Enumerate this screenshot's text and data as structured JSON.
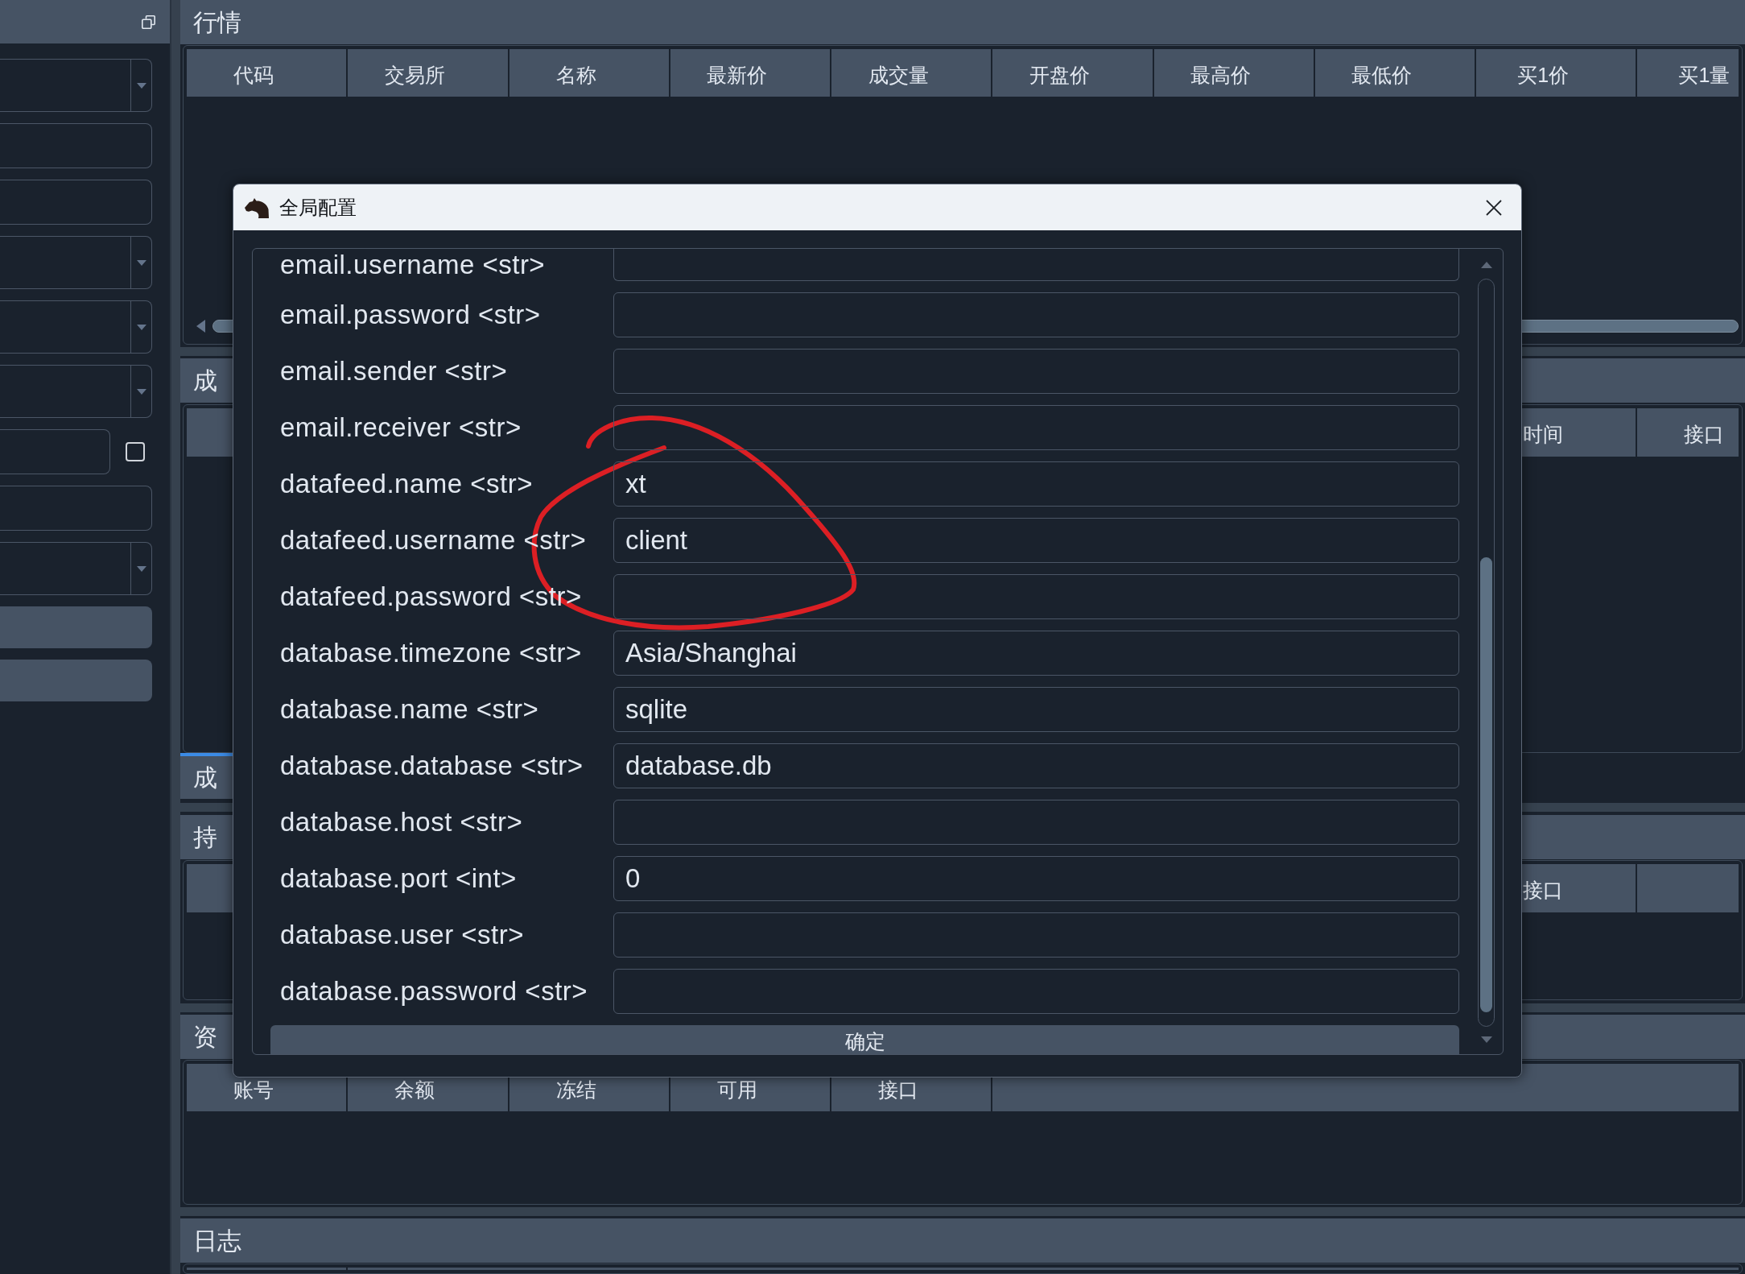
{
  "side_panel": {
    "controls": [
      {
        "kind": "dropdown"
      },
      {
        "kind": "input"
      },
      {
        "kind": "input"
      },
      {
        "kind": "dropdown"
      },
      {
        "kind": "dropdown"
      },
      {
        "kind": "dropdown"
      },
      {
        "kind": "input_checkbox",
        "checked": false
      },
      {
        "kind": "input"
      },
      {
        "kind": "dropdown"
      },
      {
        "kind": "button"
      },
      {
        "kind": "button"
      }
    ]
  },
  "docks": [
    {
      "title": "行情",
      "table": {
        "kind": "wide",
        "columns": [
          "代码",
          "交易所",
          "名称",
          "最新价",
          "成交量",
          "开盘价",
          "最高价",
          "最低价",
          "买1价",
          "买1量"
        ]
      }
    },
    {
      "title": "成",
      "table": {
        "kind": "covered",
        "columns": [
          "时间",
          "接口"
        ]
      },
      "tabs": [
        {
          "label": "成",
          "selected": true
        }
      ]
    },
    {
      "title": "持",
      "table": {
        "kind": "covered",
        "columns": [
          "接口"
        ]
      }
    },
    {
      "title": "资",
      "table": {
        "kind": "plain",
        "columns": [
          "账号",
          "余额",
          "冻结",
          "可用",
          "接口"
        ]
      }
    },
    {
      "title": "日志",
      "table": {
        "kind": "clipped"
      }
    }
  ],
  "dialog": {
    "title": "全局配置",
    "settings": [
      {
        "label": "email.username <str>"
      },
      {
        "label": "email.password <str>"
      },
      {
        "label": "email.sender <str>"
      },
      {
        "label": "email.receiver <str>"
      },
      {
        "label": "datafeed.name <str>",
        "value": "xt"
      },
      {
        "label": "datafeed.username <str>",
        "value": "client"
      },
      {
        "label": "datafeed.password <str>"
      },
      {
        "label": "database.timezone <str>",
        "value": "Asia/Shanghai"
      },
      {
        "label": "database.name <str>",
        "value": "sqlite"
      },
      {
        "label": "database.database <str>",
        "value": "database.db"
      },
      {
        "label": "database.host <str>"
      },
      {
        "label": "database.port <int>",
        "value": "0"
      },
      {
        "label": "database.user <str>"
      },
      {
        "label": "database.password <str>"
      }
    ],
    "button": "确定"
  },
  "annotations": [
    {
      "kind": "freehand_circle"
    }
  ]
}
